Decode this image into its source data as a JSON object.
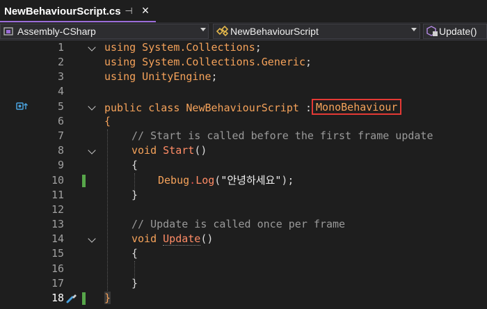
{
  "tab": {
    "title": "NewBehaviourScript.cs",
    "pin_icon": "pin-icon",
    "close_icon": "close-icon",
    "pin_glyph": "⊣",
    "close_glyph": "×"
  },
  "navbar": {
    "project": {
      "label": "Assembly-CSharp",
      "icon": "csharp-project-icon"
    },
    "class": {
      "label": "NewBehaviourScript",
      "icon": "class-icon"
    },
    "member": {
      "label": "Update()",
      "icon": "method-icon"
    }
  },
  "colors": {
    "background": "#1e1e1e",
    "keyword": "#f5a25a",
    "comment": "#9a9a9a",
    "highlight": "#e53935",
    "change_marker": "#57a64a",
    "tab_accent": "#9b6cd9"
  },
  "editor": {
    "current_line": 18,
    "lines": [
      {
        "n": "1",
        "kw": "using",
        "rest": " System.Collections",
        "end": ";"
      },
      {
        "n": "2",
        "kw": "using",
        "rest": " System.Collections.Generic",
        "end": ";"
      },
      {
        "n": "3",
        "kw": "using",
        "rest": " UnityEngine",
        "end": ";"
      },
      {
        "n": "4"
      },
      {
        "n": "5",
        "kw": "public class",
        "name": "NewBehaviourScript",
        "colon": ":",
        "base": "MonoBehaviour"
      },
      {
        "n": "6",
        "brace": "{"
      },
      {
        "n": "7",
        "comment": "// Start is called before the first frame update"
      },
      {
        "n": "8",
        "kw": "void",
        "name": "Start",
        "paren": "()"
      },
      {
        "n": "9",
        "brace": "{"
      },
      {
        "n": "10",
        "obj": "Debug",
        "dot": ".",
        "method": "Log",
        "open": "(",
        "string": "\"안녕하세요\"",
        "close": ");"
      },
      {
        "n": "11",
        "brace": "}"
      },
      {
        "n": "12"
      },
      {
        "n": "13",
        "comment": "// Update is called once per frame"
      },
      {
        "n": "14",
        "kw": "void",
        "name": "Update",
        "paren": "()"
      },
      {
        "n": "15",
        "brace": "{"
      },
      {
        "n": "16"
      },
      {
        "n": "17",
        "brace": "}"
      },
      {
        "n": "18",
        "brace": "}"
      }
    ]
  }
}
